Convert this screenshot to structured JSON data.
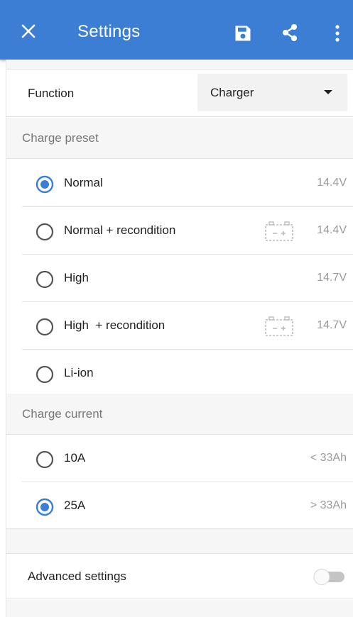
{
  "appbar": {
    "title": "Settings",
    "close_icon": "close-icon",
    "save_icon": "save-icon",
    "share_icon": "share-icon",
    "menu_icon": "more-vert-icon",
    "color": "#3b7ed4"
  },
  "function": {
    "label": "Function",
    "selected": "Charger"
  },
  "charge_preset": {
    "header": "Charge preset",
    "items": [
      {
        "label": "Normal",
        "voltage": "14.4V",
        "selected": true,
        "battery_icon": false
      },
      {
        "label": "Normal + recondition",
        "voltage": "14.4V",
        "selected": false,
        "battery_icon": true
      },
      {
        "label": "High",
        "voltage": "14.7V",
        "selected": false,
        "battery_icon": false
      },
      {
        "label": "High  + recondition",
        "voltage": "14.7V",
        "selected": false,
        "battery_icon": true
      },
      {
        "label": "Li-ion",
        "voltage": "",
        "selected": false,
        "battery_icon": false
      }
    ]
  },
  "charge_current": {
    "header": "Charge current",
    "items": [
      {
        "label": "10A",
        "capacity": "< 33Ah",
        "selected": false
      },
      {
        "label": "25A",
        "capacity": "> 33Ah",
        "selected": true
      }
    ]
  },
  "advanced": {
    "label": "Advanced settings",
    "enabled": false
  },
  "colors": {
    "accent": "#3b7ed4",
    "radio_unselected": "#555555",
    "secondary_text": "#9a9a9a"
  }
}
